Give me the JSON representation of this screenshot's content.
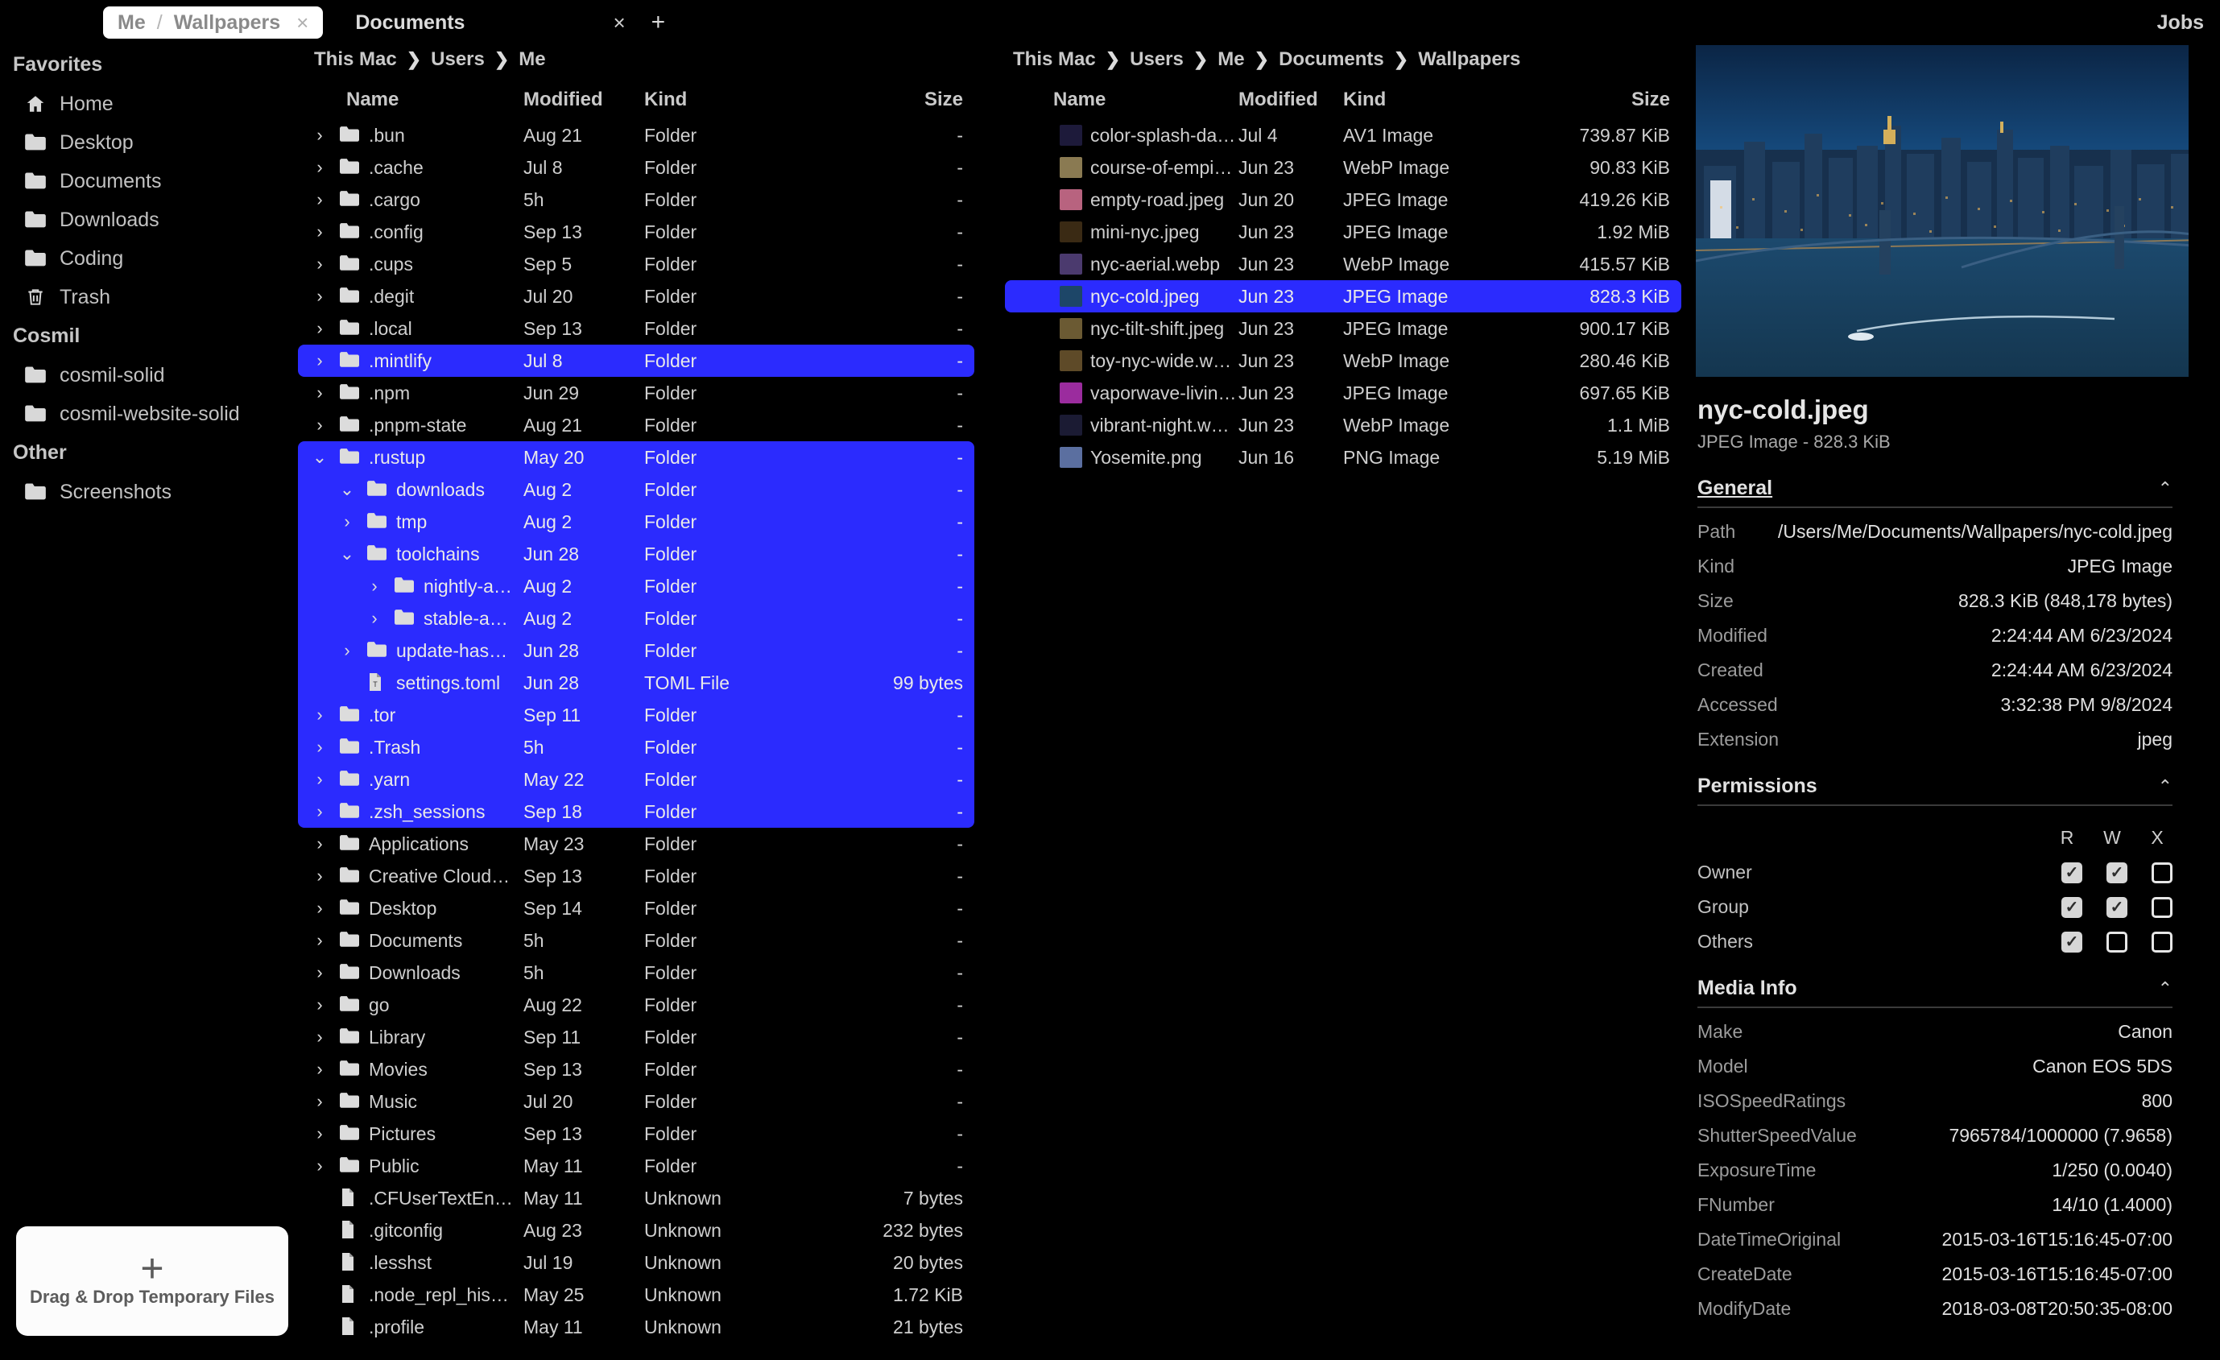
{
  "window": {
    "jobs_label": "Jobs"
  },
  "tabs": [
    {
      "prefix": "Me",
      "sep": "/",
      "label": "Wallpapers",
      "close": "×",
      "active": true
    },
    {
      "prefix": "",
      "sep": "",
      "label": "Documents",
      "close": "×",
      "active": false
    }
  ],
  "new_tab_label": "+",
  "sidebar": {
    "sections": [
      {
        "title": "Favorites",
        "items": [
          {
            "label": "Home",
            "icon": "home-icon"
          },
          {
            "label": "Desktop",
            "icon": "folder-icon"
          },
          {
            "label": "Documents",
            "icon": "folder-icon"
          },
          {
            "label": "Downloads",
            "icon": "folder-icon"
          },
          {
            "label": "Coding",
            "icon": "folder-icon"
          },
          {
            "label": "Trash",
            "icon": "trash-icon"
          }
        ]
      },
      {
        "title": "Cosmil",
        "items": [
          {
            "label": "cosmil-solid",
            "icon": "folder-icon"
          },
          {
            "label": "cosmil-website-solid",
            "icon": "folder-icon"
          }
        ]
      },
      {
        "title": "Other",
        "items": [
          {
            "label": "Screenshots",
            "icon": "folder-icon"
          }
        ]
      }
    ],
    "dropzone": {
      "plus": "+",
      "text": "Drag & Drop Temporary Files"
    }
  },
  "left_pane": {
    "breadcrumb": [
      "This Mac",
      "Users",
      "Me"
    ],
    "columns": {
      "name": "Name",
      "modified": "Modified",
      "kind": "Kind",
      "size": "Size"
    },
    "rows": [
      {
        "disc": "›",
        "icon": "folder-icon",
        "name": ".bun",
        "modified": "Aug 21",
        "kind": "Folder",
        "size": "-",
        "selected": false
      },
      {
        "disc": "›",
        "icon": "folder-icon",
        "name": ".cache",
        "modified": "Jul 8",
        "kind": "Folder",
        "size": "-",
        "selected": false
      },
      {
        "disc": "›",
        "icon": "folder-icon",
        "name": ".cargo",
        "modified": "5h",
        "kind": "Folder",
        "size": "-",
        "selected": false
      },
      {
        "disc": "›",
        "icon": "folder-icon",
        "name": ".config",
        "modified": "Sep 13",
        "kind": "Folder",
        "size": "-",
        "selected": false
      },
      {
        "disc": "›",
        "icon": "folder-icon",
        "name": ".cups",
        "modified": "Sep 5",
        "kind": "Folder",
        "size": "-",
        "selected": false
      },
      {
        "disc": "›",
        "icon": "folder-icon",
        "name": ".degit",
        "modified": "Jul 20",
        "kind": "Folder",
        "size": "-",
        "selected": false
      },
      {
        "disc": "›",
        "icon": "folder-icon",
        "name": ".local",
        "modified": "Sep 13",
        "kind": "Folder",
        "size": "-",
        "selected": false
      },
      {
        "disc": "›",
        "icon": "folder-icon",
        "name": ".mintlify",
        "modified": "Jul 8",
        "kind": "Folder",
        "size": "-",
        "selected": true,
        "indent": 0
      },
      {
        "disc": "›",
        "icon": "folder-icon",
        "name": ".npm",
        "modified": "Jun 29",
        "kind": "Folder",
        "size": "-",
        "selected": false
      },
      {
        "disc": "›",
        "icon": "folder-icon",
        "name": ".pnpm-state",
        "modified": "Aug 21",
        "kind": "Folder",
        "size": "-",
        "selected": false
      },
      {
        "disc": "⌄",
        "icon": "folder-icon",
        "name": ".rustup",
        "modified": "May 20",
        "kind": "Folder",
        "size": "-",
        "selected": true,
        "indent": 0
      },
      {
        "disc": "⌄",
        "icon": "folder-icon",
        "name": "downloads",
        "modified": "Aug 2",
        "kind": "Folder",
        "size": "-",
        "selected": true,
        "indent": 1
      },
      {
        "disc": "›",
        "icon": "folder-icon",
        "name": "tmp",
        "modified": "Aug 2",
        "kind": "Folder",
        "size": "-",
        "selected": true,
        "indent": 1
      },
      {
        "disc": "⌄",
        "icon": "folder-icon",
        "name": "toolchains",
        "modified": "Jun 28",
        "kind": "Folder",
        "size": "-",
        "selected": true,
        "indent": 1
      },
      {
        "disc": "›",
        "icon": "folder-icon",
        "name": "nightly-a…",
        "modified": "Aug 2",
        "kind": "Folder",
        "size": "-",
        "selected": true,
        "indent": 2
      },
      {
        "disc": "›",
        "icon": "folder-icon",
        "name": "stable-a…",
        "modified": "Aug 2",
        "kind": "Folder",
        "size": "-",
        "selected": true,
        "indent": 2
      },
      {
        "disc": "›",
        "icon": "folder-icon",
        "name": "update-has…",
        "modified": "Jun 28",
        "kind": "Folder",
        "size": "-",
        "selected": true,
        "indent": 1
      },
      {
        "disc": "",
        "icon": "toml-file-icon",
        "name": "settings.toml",
        "modified": "Jun 28",
        "kind": "TOML File",
        "size": "99 bytes",
        "selected": true,
        "indent": 1
      },
      {
        "disc": "›",
        "icon": "folder-icon",
        "name": ".tor",
        "modified": "Sep 11",
        "kind": "Folder",
        "size": "-",
        "selected": true,
        "indent": 0
      },
      {
        "disc": "›",
        "icon": "folder-icon",
        "name": ".Trash",
        "modified": "5h",
        "kind": "Folder",
        "size": "-",
        "selected": true,
        "indent": 0
      },
      {
        "disc": "›",
        "icon": "folder-icon",
        "name": ".yarn",
        "modified": "May 22",
        "kind": "Folder",
        "size": "-",
        "selected": true,
        "indent": 0
      },
      {
        "disc": "›",
        "icon": "folder-icon",
        "name": ".zsh_sessions",
        "modified": "Sep 18",
        "kind": "Folder",
        "size": "-",
        "selected": true,
        "indent": 0
      },
      {
        "disc": "›",
        "icon": "folder-icon",
        "name": "Applications",
        "modified": "May 23",
        "kind": "Folder",
        "size": "-",
        "selected": false
      },
      {
        "disc": "›",
        "icon": "folder-icon",
        "name": "Creative Cloud…",
        "modified": "Sep 13",
        "kind": "Folder",
        "size": "-",
        "selected": false
      },
      {
        "disc": "›",
        "icon": "folder-icon",
        "name": "Desktop",
        "modified": "Sep 14",
        "kind": "Folder",
        "size": "-",
        "selected": false
      },
      {
        "disc": "›",
        "icon": "folder-icon",
        "name": "Documents",
        "modified": "5h",
        "kind": "Folder",
        "size": "-",
        "selected": false
      },
      {
        "disc": "›",
        "icon": "folder-icon",
        "name": "Downloads",
        "modified": "5h",
        "kind": "Folder",
        "size": "-",
        "selected": false
      },
      {
        "disc": "›",
        "icon": "folder-icon",
        "name": "go",
        "modified": "Aug 22",
        "kind": "Folder",
        "size": "-",
        "selected": false
      },
      {
        "disc": "›",
        "icon": "folder-icon",
        "name": "Library",
        "modified": "Sep 11",
        "kind": "Folder",
        "size": "-",
        "selected": false
      },
      {
        "disc": "›",
        "icon": "folder-icon",
        "name": "Movies",
        "modified": "Sep 13",
        "kind": "Folder",
        "size": "-",
        "selected": false
      },
      {
        "disc": "›",
        "icon": "folder-icon",
        "name": "Music",
        "modified": "Jul 20",
        "kind": "Folder",
        "size": "-",
        "selected": false
      },
      {
        "disc": "›",
        "icon": "folder-icon",
        "name": "Pictures",
        "modified": "Sep 13",
        "kind": "Folder",
        "size": "-",
        "selected": false
      },
      {
        "disc": "›",
        "icon": "folder-icon",
        "name": "Public",
        "modified": "May 11",
        "kind": "Folder",
        "size": "-",
        "selected": false
      },
      {
        "disc": "",
        "icon": "file-icon",
        "name": ".CFUserTextEn…",
        "modified": "May 11",
        "kind": "Unknown",
        "size": "7 bytes",
        "selected": false
      },
      {
        "disc": "",
        "icon": "file-icon",
        "name": ".gitconfig",
        "modified": "Aug 23",
        "kind": "Unknown",
        "size": "232 bytes",
        "selected": false
      },
      {
        "disc": "",
        "icon": "file-icon",
        "name": ".lesshst",
        "modified": "Jul 19",
        "kind": "Unknown",
        "size": "20 bytes",
        "selected": false
      },
      {
        "disc": "",
        "icon": "file-icon",
        "name": ".node_repl_his…",
        "modified": "May 25",
        "kind": "Unknown",
        "size": "1.72 KiB",
        "selected": false
      },
      {
        "disc": "",
        "icon": "file-icon",
        "name": ".profile",
        "modified": "May 11",
        "kind": "Unknown",
        "size": "21 bytes",
        "selected": false
      }
    ]
  },
  "right_pane": {
    "breadcrumb": [
      "This Mac",
      "Users",
      "Me",
      "Documents",
      "Wallpapers"
    ],
    "columns": {
      "name": "Name",
      "modified": "Modified",
      "kind": "Kind",
      "size": "Size"
    },
    "rows": [
      {
        "icon": "image-thumb",
        "thumb": "#1d1a3a",
        "name": "color-splash-da…",
        "modified": "Jul 4",
        "kind": "AV1 Image",
        "size": "739.87 KiB",
        "selected": false
      },
      {
        "icon": "image-thumb",
        "thumb": "#8a7a52",
        "name": "course-of-empi…",
        "modified": "Jun 23",
        "kind": "WebP Image",
        "size": "90.83 KiB",
        "selected": false
      },
      {
        "icon": "image-thumb",
        "thumb": "#b8637f",
        "name": "empty-road.jpeg",
        "modified": "Jun 20",
        "kind": "JPEG Image",
        "size": "419.26 KiB",
        "selected": false
      },
      {
        "icon": "image-thumb",
        "thumb": "#3a2a14",
        "name": "mini-nyc.jpeg",
        "modified": "Jun 23",
        "kind": "JPEG Image",
        "size": "1.92 MiB",
        "selected": false
      },
      {
        "icon": "image-thumb",
        "thumb": "#4b3a6e",
        "name": "nyc-aerial.webp",
        "modified": "Jun 23",
        "kind": "WebP Image",
        "size": "415.57 KiB",
        "selected": false
      },
      {
        "icon": "image-thumb",
        "thumb": "#1d4668",
        "name": "nyc-cold.jpeg",
        "modified": "Jun 23",
        "kind": "JPEG Image",
        "size": "828.3 KiB",
        "selected": true
      },
      {
        "icon": "image-thumb",
        "thumb": "#6b5a33",
        "name": "nyc-tilt-shift.jpeg",
        "modified": "Jun 23",
        "kind": "JPEG Image",
        "size": "900.17 KiB",
        "selected": false
      },
      {
        "icon": "image-thumb",
        "thumb": "#5e4a28",
        "name": "toy-nyc-wide.w…",
        "modified": "Jun 23",
        "kind": "WebP Image",
        "size": "280.46 KiB",
        "selected": false
      },
      {
        "icon": "image-thumb",
        "thumb": "#9b2c9e",
        "name": "vaporwave-livin…",
        "modified": "Jun 23",
        "kind": "JPEG Image",
        "size": "697.65 KiB",
        "selected": false
      },
      {
        "icon": "image-thumb",
        "thumb": "#1b1b33",
        "name": "vibrant-night.we…",
        "modified": "Jun 23",
        "kind": "WebP Image",
        "size": "1.1 MiB",
        "selected": false
      },
      {
        "icon": "image-thumb",
        "thumb": "#5b6fa0",
        "name": "Yosemite.png",
        "modified": "Jun 16",
        "kind": "PNG Image",
        "size": "5.19 MiB",
        "selected": false
      }
    ]
  },
  "inspector": {
    "preview_alt": "nyc-cold-preview",
    "title": "nyc-cold.jpeg",
    "subtitle": "JPEG Image - 828.3 KiB",
    "general": {
      "heading": "General",
      "caret": "⌃",
      "fields": [
        {
          "key": "Path",
          "value": "/Users/Me/Documents/Wallpapers/nyc-cold.jpeg"
        },
        {
          "key": "Kind",
          "value": "JPEG Image"
        },
        {
          "key": "Size",
          "value": "828.3 KiB (848,178 bytes)"
        },
        {
          "key": "Modified",
          "value": "2:24:44 AM 6/23/2024"
        },
        {
          "key": "Created",
          "value": "2:24:44 AM 6/23/2024"
        },
        {
          "key": "Accessed",
          "value": "3:32:38 PM 9/8/2024"
        },
        {
          "key": "Extension",
          "value": "jpeg"
        }
      ]
    },
    "permissions": {
      "heading": "Permissions",
      "caret": "⌃",
      "columns": [
        "R",
        "W",
        "X"
      ],
      "rows": [
        {
          "name": "Owner",
          "r": true,
          "w": true,
          "x": false
        },
        {
          "name": "Group",
          "r": true,
          "w": true,
          "x": false
        },
        {
          "name": "Others",
          "r": true,
          "w": false,
          "x": false
        }
      ],
      "check": "✓"
    },
    "media_info": {
      "heading": "Media Info",
      "caret": "⌃",
      "fields": [
        {
          "key": "Make",
          "value": "Canon"
        },
        {
          "key": "Model",
          "value": "Canon EOS 5DS"
        },
        {
          "key": "ISOSpeedRatings",
          "value": "800"
        },
        {
          "key": "ShutterSpeedValue",
          "value": "7965784/1000000 (7.9658)"
        },
        {
          "key": "ExposureTime",
          "value": "1/250 (0.0040)"
        },
        {
          "key": "FNumber",
          "value": "14/10 (1.4000)"
        },
        {
          "key": "DateTimeOriginal",
          "value": "2015-03-16T15:16:45-07:00"
        },
        {
          "key": "CreateDate",
          "value": "2015-03-16T15:16:45-07:00"
        },
        {
          "key": "ModifyDate",
          "value": "2018-03-08T20:50:35-08:00"
        }
      ]
    }
  },
  "colors": {
    "selection": "#2B2BFE",
    "background": "#000000",
    "text": "#d0d0d0",
    "tab_active_bg": "#ffffff"
  }
}
